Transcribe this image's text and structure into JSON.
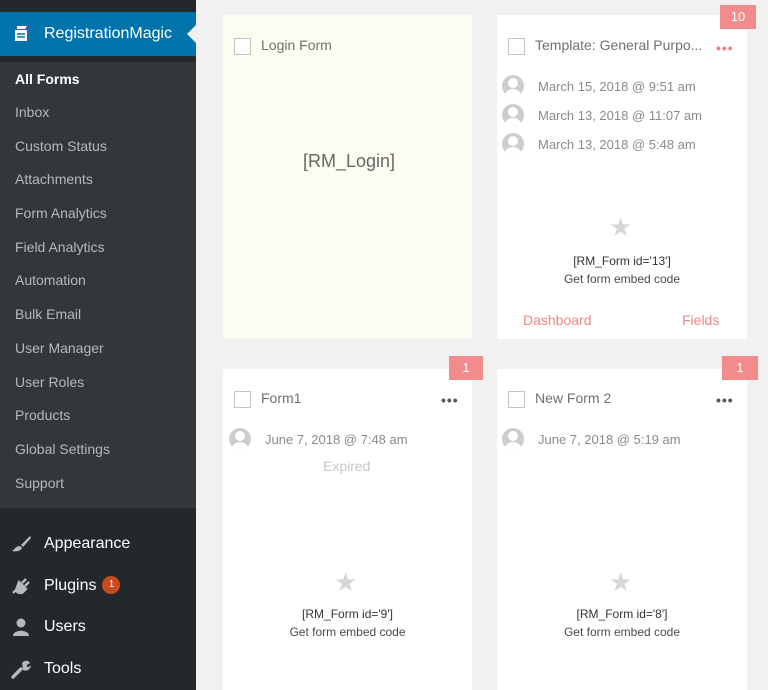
{
  "sidebar": {
    "plugin_title": "RegistrationMagic",
    "submenu": [
      {
        "label": "All Forms",
        "active": true
      },
      {
        "label": "Inbox"
      },
      {
        "label": "Custom Status"
      },
      {
        "label": "Attachments"
      },
      {
        "label": "Form Analytics"
      },
      {
        "label": "Field Analytics"
      },
      {
        "label": "Automation"
      },
      {
        "label": "Bulk Email"
      },
      {
        "label": "User Manager"
      },
      {
        "label": "User Roles"
      },
      {
        "label": "Products"
      },
      {
        "label": "Global Settings"
      },
      {
        "label": "Support"
      }
    ],
    "menu": [
      {
        "label": "Appearance",
        "icon": "paintbrush-icon"
      },
      {
        "label": "Plugins",
        "icon": "plugin-icon",
        "badge": "1"
      },
      {
        "label": "Users",
        "icon": "users-icon"
      },
      {
        "label": "Tools",
        "icon": "wrench-icon"
      }
    ]
  },
  "cards": [
    {
      "title": "Login Form",
      "shortcode": "[RM_Login]"
    },
    {
      "title": "Template: General Purpo...",
      "badge": "10",
      "submissions": [
        "March 15, 2018 @ 9:51 am",
        "March 13, 2018 @ 11:07 am",
        "March 13, 2018 @ 5:48 am"
      ],
      "shortcode": "[RM_Form id='13']",
      "embed": "Get form embed code",
      "links": [
        "Dashboard",
        "Fields"
      ]
    },
    {
      "title": "Form1",
      "badge": "1",
      "submissions": [
        "June 7, 2018 @ 7:48 am"
      ],
      "status": "Expired",
      "shortcode": "[RM_Form id='9']",
      "embed": "Get form embed code"
    },
    {
      "title": "New Form 2",
      "badge": "1",
      "submissions": [
        "June 7, 2018 @ 5:19 am"
      ],
      "shortcode": "[RM_Form id='8']",
      "embed": "Get form embed code"
    }
  ],
  "colors": {
    "sidebar_bg": "#23282d",
    "submenu_bg": "#32373c",
    "accent": "#0073aa",
    "badge": "#f28b8b",
    "link": "#f08686",
    "plugins_badge": "#ca4a1f"
  }
}
